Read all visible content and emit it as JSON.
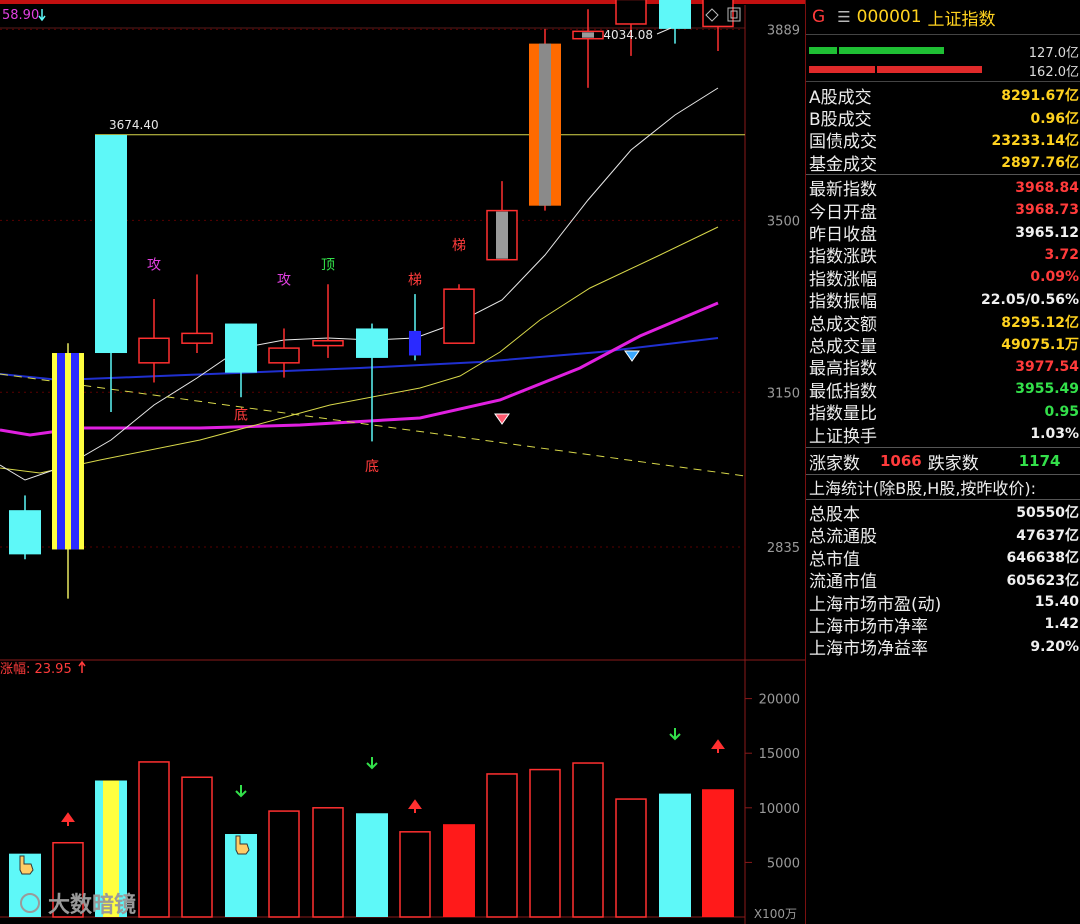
{
  "header": {
    "tag": "G",
    "menu_icon": "menu-icon",
    "code": "000001",
    "name": "上证指数"
  },
  "order_book": {
    "bid_total": "127.0亿",
    "ask_total": "162.0亿"
  },
  "trading": [
    {
      "label": "A股成交",
      "value": "8291.67亿",
      "color": "#ffd21f"
    },
    {
      "label": "B股成交",
      "value": "0.96亿",
      "color": "#ffd21f"
    },
    {
      "label": "国债成交",
      "value": "23233.14亿",
      "color": "#ffd21f"
    },
    {
      "label": "基金成交",
      "value": "2897.76亿",
      "color": "#ffd21f"
    }
  ],
  "quote": [
    {
      "label": "最新指数",
      "value": "3968.84",
      "color": "#ff3b3b"
    },
    {
      "label": "今日开盘",
      "value": "3968.73",
      "color": "#ff3b3b"
    },
    {
      "label": "昨日收盘",
      "value": "3965.12",
      "color": "#f0f0f0"
    },
    {
      "label": "指数涨跌",
      "value": "3.72",
      "color": "#ff3b3b"
    },
    {
      "label": "指数涨幅",
      "value": "0.09%",
      "color": "#ff3b3b"
    },
    {
      "label": "指数振幅",
      "value": "22.05/0.56%",
      "color": "#f0f0f0"
    },
    {
      "label": "总成交额",
      "value": "8295.12亿",
      "color": "#ffd21f"
    },
    {
      "label": "总成交量",
      "value": "49075.1万",
      "color": "#ffd21f"
    },
    {
      "label": "最高指数",
      "value": "3977.54",
      "color": "#ff3b3b"
    },
    {
      "label": "最低指数",
      "value": "3955.49",
      "color": "#33e04a"
    },
    {
      "label": "指数量比",
      "value": "0.95",
      "color": "#33e04a"
    },
    {
      "label": "上证换手",
      "value": "1.03%",
      "color": "#f0f0f0"
    }
  ],
  "breadth": {
    "up_label": "涨家数",
    "up_value": "1066",
    "down_label": "跌家数",
    "down_value": "1174"
  },
  "stats_header": "上海统计(除B股,H股,按昨收价):",
  "stats": [
    {
      "label": "总股本",
      "value": "50550亿"
    },
    {
      "label": "总流通股",
      "value": "47637亿"
    },
    {
      "label": "总市值",
      "value": "646638亿"
    },
    {
      "label": "流通市值",
      "value": "605623亿"
    },
    {
      "label": "上海市场市盈(动)",
      "value": "15.40"
    },
    {
      "label": "上海市场市净率",
      "value": "1.42"
    },
    {
      "label": "上海市场净益率",
      "value": "9.20%"
    }
  ],
  "chart_data": {
    "type": "candlestick",
    "top_left_label": "58.90",
    "y_ticks": [
      2835,
      3150,
      3500,
      3889
    ],
    "high_label": "4034.08",
    "ref_line_label": "3674.40",
    "ref_line_value": 3674.4,
    "candles": [
      {
        "o": 2820,
        "c": 2910,
        "h": 2940,
        "l": 2810,
        "color": "cyan"
      },
      {
        "o": 3230,
        "c": 2830,
        "h": 3250,
        "l": 2730,
        "color": "yellow-blue"
      },
      {
        "o": 3230,
        "c": 3674,
        "h": 3674,
        "l": 3110,
        "color": "cyan"
      },
      {
        "o": 3210,
        "c": 3260,
        "h": 3340,
        "l": 3170,
        "color": "red"
      },
      {
        "o": 3250,
        "c": 3270,
        "h": 3390,
        "l": 3230,
        "color": "red"
      },
      {
        "o": 3190,
        "c": 3290,
        "h": 3290,
        "l": 3140,
        "color": "cyan"
      },
      {
        "o": 3210,
        "c": 3240,
        "h": 3280,
        "l": 3180,
        "color": "red"
      },
      {
        "o": 3245,
        "c": 3255,
        "h": 3370,
        "l": 3220,
        "color": "red"
      },
      {
        "o": 3220,
        "c": 3280,
        "h": 3290,
        "l": 3050,
        "color": "cyan"
      },
      {
        "o": 3225,
        "c": 3275,
        "h": 3350,
        "l": 3215,
        "color": "blue"
      },
      {
        "o": 3250,
        "c": 3360,
        "h": 3370,
        "l": 3250,
        "color": "red"
      },
      {
        "o": 3420,
        "c": 3520,
        "h": 3580,
        "l": 3420,
        "color": "gray"
      },
      {
        "o": 3530,
        "c": 3860,
        "h": 3890,
        "l": 3520,
        "color": "orange"
      },
      {
        "o": 3870,
        "c": 3885,
        "h": 3930,
        "l": 3770,
        "color": "gray"
      },
      {
        "o": 3900,
        "c": 3950,
        "h": 4005,
        "l": 3835,
        "color": "red"
      },
      {
        "o": 3890,
        "c": 3950,
        "h": 4034,
        "l": 3860,
        "color": "cyan"
      },
      {
        "o": 3895,
        "c": 3960,
        "h": 3977,
        "l": 3845,
        "color": "red"
      }
    ],
    "markers": [
      {
        "i": 3,
        "text": "攻",
        "color": "#e040e0",
        "v": 3400
      },
      {
        "i": 6,
        "text": "攻",
        "color": "#e040e0",
        "v": 3370
      },
      {
        "i": 7,
        "text": "顶",
        "color": "#33e04a",
        "v": 3400
      },
      {
        "i": 9,
        "text": "梯",
        "color": "#ff3b3b",
        "v": 3370
      },
      {
        "i": 10,
        "text": "梯",
        "color": "#ff3b3b",
        "v": 3440
      },
      {
        "i": 8,
        "text": "底",
        "color": "#ff3b3b",
        "v": 2990
      },
      {
        "i": 5,
        "text": "底",
        "color": "#ff3b3b",
        "v": 3095
      }
    ],
    "volume": {
      "label": "涨幅: 23.95",
      "unit": "X100万",
      "y_ticks": [
        5000,
        10000,
        15000,
        20000
      ],
      "bars": [
        {
          "v": 5800,
          "color": "cyan"
        },
        {
          "v": 6800,
          "color": "red-hollow"
        },
        {
          "v": 12500,
          "color": "yellow-cyan"
        },
        {
          "v": 14200,
          "color": "red-hollow"
        },
        {
          "v": 12800,
          "color": "red-hollow"
        },
        {
          "v": 7600,
          "color": "cyan"
        },
        {
          "v": 9700,
          "color": "red-hollow"
        },
        {
          "v": 10000,
          "color": "red-hollow"
        },
        {
          "v": 9500,
          "color": "cyan"
        },
        {
          "v": 7800,
          "color": "red-hollow"
        },
        {
          "v": 8500,
          "color": "red-fill"
        },
        {
          "v": 13100,
          "color": "red-hollow"
        },
        {
          "v": 13500,
          "color": "red-hollow"
        },
        {
          "v": 14100,
          "color": "red-hollow"
        },
        {
          "v": 10800,
          "color": "red-hollow"
        },
        {
          "v": 11300,
          "color": "cyan"
        },
        {
          "v": 11700,
          "color": "red-fill"
        }
      ]
    },
    "watermark": "大数暗镜"
  }
}
